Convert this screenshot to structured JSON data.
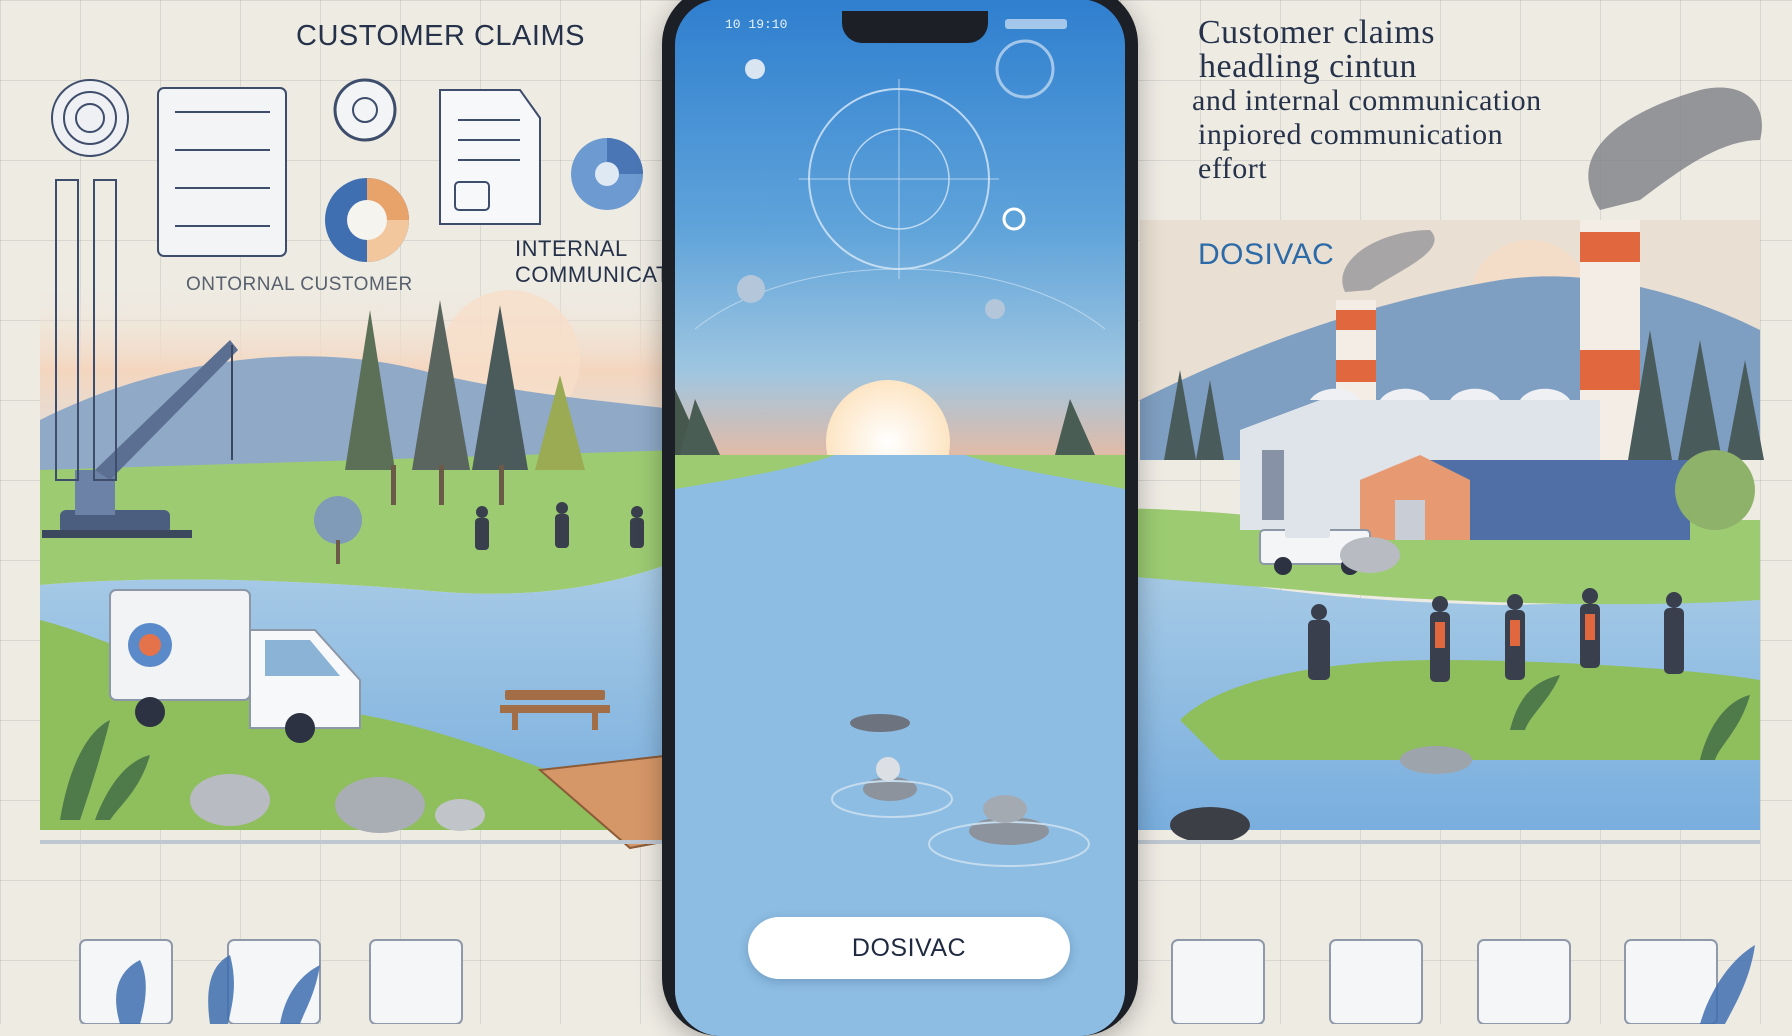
{
  "left_panel": {
    "title": "CUSTOMER CLAIMS",
    "caption_customer": "ONTORNAL CUSTOMER",
    "caption_internal": "INTERNAL\nCOMMUNICAT",
    "gauge_label": "%"
  },
  "phone": {
    "status_time": "10 19:10",
    "button_label": "DOSIVAC"
  },
  "right_panel": {
    "title_line1": "Customer claims",
    "title_line2": "headling  cintun",
    "title_line3": "and internal communication",
    "title_line4": "inpiored communication",
    "title_line5": "effort",
    "brand": "DOSIVAC"
  },
  "colors": {
    "sky_top": "#2f7fcf",
    "sunset": "#f2b89a",
    "water": "#8fbde3",
    "grass": "#8fc46a",
    "factory_stripe": "#e0673e",
    "ink": "#26324a",
    "brand_blue": "#2c6aa8"
  },
  "icons": [
    "target-icon",
    "document-icon",
    "pie-chart-icon",
    "list-panel-icon",
    "grid-icon"
  ]
}
